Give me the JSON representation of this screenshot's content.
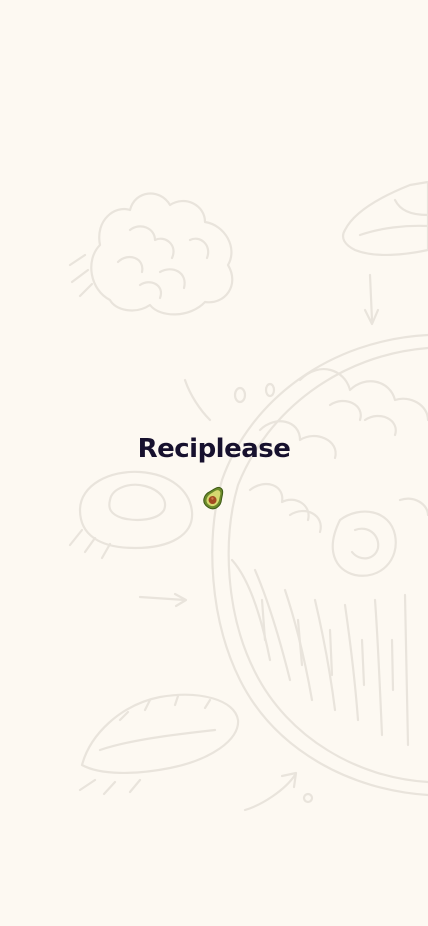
{
  "app": {
    "title": "Reciplease"
  },
  "logo": {
    "icon": "avocado-icon"
  },
  "background": {
    "illustration": "food-sketch-illustration",
    "color": "#fdf9f2",
    "line_color": "#e9e4dc"
  },
  "colors": {
    "title": "#17112e",
    "avocado_skin": "#6a8a2a",
    "avocado_flesh": "#d6d870",
    "avocado_pit": "#a34a20"
  }
}
